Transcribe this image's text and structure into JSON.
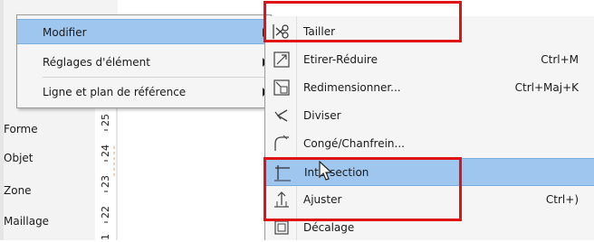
{
  "background_panel": {
    "items": [
      "Forme",
      "Objet",
      "Zone",
      "Maillage"
    ],
    "ruler_ticks": [
      "25",
      "24",
      "23",
      "22",
      "1"
    ]
  },
  "context_menu": {
    "items": [
      {
        "label": "Modifier",
        "submenu": true,
        "highlighted": true
      },
      {
        "label": "Réglages d'élément",
        "submenu": true,
        "highlighted": false
      },
      {
        "label": "Ligne et plan de référence",
        "submenu": true,
        "highlighted": false
      }
    ]
  },
  "submenu": {
    "items": [
      {
        "label": "Tailler",
        "shortcut": "",
        "icon": "scissors-icon",
        "highlighted": false
      },
      {
        "label": "Etirer-Réduire",
        "shortcut": "Ctrl+M",
        "icon": "stretch-icon",
        "highlighted": false
      },
      {
        "label": "Redimensionner...",
        "shortcut": "Ctrl+Maj+K",
        "icon": "resize-icon",
        "highlighted": false
      },
      {
        "label": "Diviser",
        "shortcut": "",
        "icon": "split-icon",
        "highlighted": false
      },
      {
        "label": "Congé/Chanfrein...",
        "shortcut": "",
        "icon": "fillet-icon",
        "highlighted": false
      },
      {
        "label": "Intersection",
        "shortcut": "",
        "icon": "intersection-icon",
        "highlighted": true
      },
      {
        "label": "Ajuster",
        "shortcut": "Ctrl+)",
        "icon": "adjust-icon",
        "highlighted": false
      },
      {
        "label": "Décalage",
        "shortcut": "",
        "icon": "offset-icon",
        "highlighted": false
      }
    ]
  },
  "colors": {
    "highlight": "#9fc6ef",
    "annotation": "#e01414"
  }
}
